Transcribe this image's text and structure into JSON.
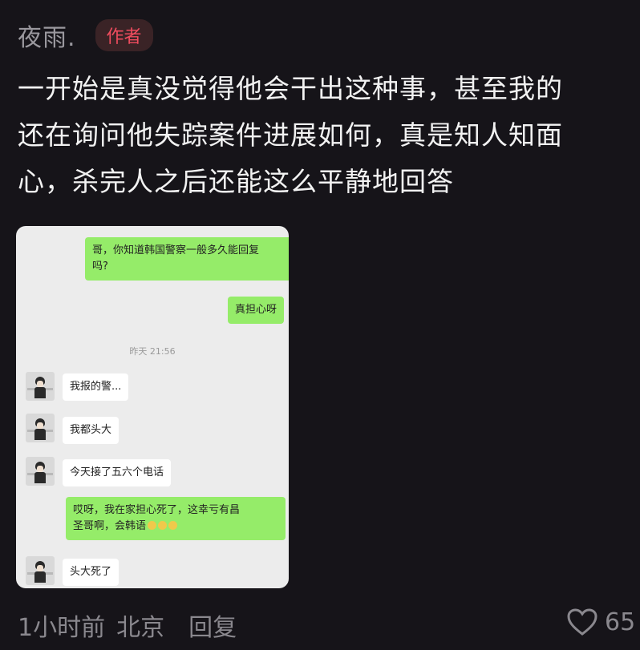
{
  "comment": {
    "username": "夜雨.",
    "author_badge": "作者",
    "text": "一开始是真没觉得他会干出这种事，甚至我的\n还在询问他失踪案件进展如何，真是知人知面\n心，杀完人之后还能这么平静地回答"
  },
  "chat": {
    "messages": [
      {
        "side": "right",
        "text": "哥，你知道韩国警察一般多久能回复\n吗?"
      },
      {
        "side": "right",
        "text": "真担心呀"
      },
      {
        "side": "left",
        "text": "我报的警..."
      },
      {
        "side": "left",
        "text": "我都头大"
      },
      {
        "side": "left",
        "text": "今天接了五六个电话"
      },
      {
        "side": "right",
        "text": "哎呀，我在家担心死了，这幸亏有昌\n圣哥啊，会韩语"
      },
      {
        "side": "left",
        "text": "头大死了"
      }
    ],
    "timestamp": "昨天 21:56"
  },
  "footer": {
    "time": "1小时前",
    "location": "北京",
    "reply": "回复",
    "likes": "65"
  },
  "icons": [
    "heart-icon",
    "avatar",
    "smile-emoji"
  ]
}
